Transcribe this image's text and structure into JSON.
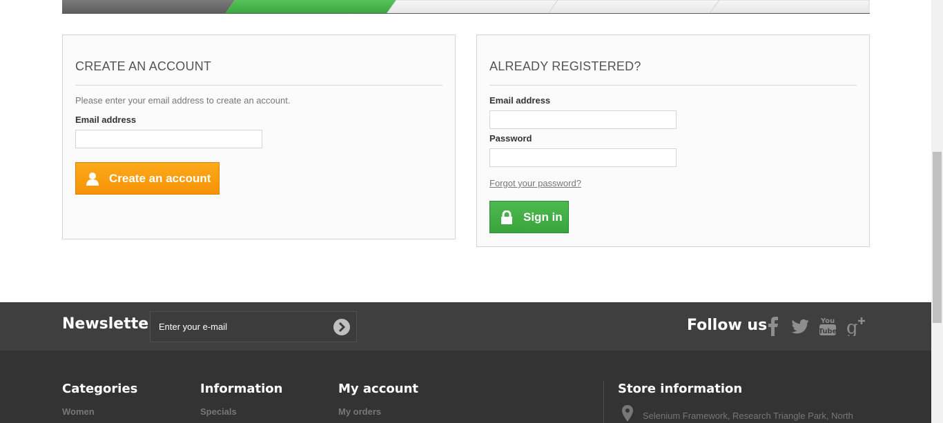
{
  "create_account": {
    "title": "CREATE AN ACCOUNT",
    "hint": "Please enter your email address to create an account.",
    "email_label": "Email address",
    "email_value": "",
    "button_label": "Create an account",
    "button_icon": "user-icon"
  },
  "login": {
    "title": "ALREADY REGISTERED?",
    "email_label": "Email address",
    "email_value": "",
    "password_label": "Password",
    "password_value": "",
    "forgot_label": "Forgot your password?",
    "button_label": "Sign in",
    "button_icon": "lock-icon"
  },
  "newsletter": {
    "title": "Newsletter",
    "placeholder": "Enter your e-mail",
    "submit_icon": "chevron-right-circle-icon"
  },
  "follow": {
    "title": "Follow us",
    "icons": [
      "facebook-icon",
      "twitter-icon",
      "youtube-icon",
      "google-plus-icon"
    ]
  },
  "footer": {
    "categories": {
      "title": "Categories",
      "first_link": "Women"
    },
    "information": {
      "title": "Information",
      "first_link": "Specials"
    },
    "my_account": {
      "title": "My account",
      "first_link": "My orders"
    },
    "store": {
      "title": "Store information",
      "address": "Selenium Framework, Research Triangle Park, North"
    }
  },
  "colors": {
    "accent_orange": "#f79306",
    "accent_green": "#3aa43d",
    "footer_dark": "#333333",
    "newsletter_band": "#3f3f3f"
  }
}
